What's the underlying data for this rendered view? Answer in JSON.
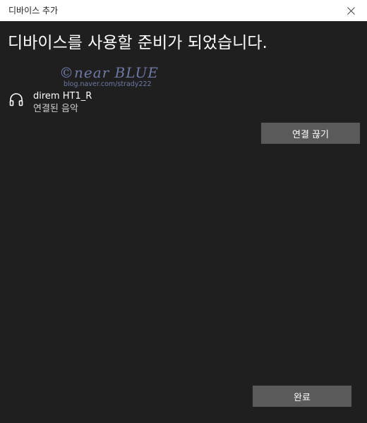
{
  "window": {
    "title": "디바이스 추가",
    "heading": "디바이스를 사용할 준비가 되었습니다."
  },
  "watermark": {
    "main": "©near BLUE",
    "sub": "blog.naver.com/strady222"
  },
  "device": {
    "icon": "headphones-icon",
    "name": "direm HT1_R",
    "status": "연결된 음악"
  },
  "buttons": {
    "disconnect_label": "연결 끊기",
    "done_label": "완료"
  },
  "colors": {
    "background": "#1f1f1f",
    "titlebar": "#ffffff",
    "button": "#5a5a5a",
    "watermark": "#6e7aa6"
  }
}
